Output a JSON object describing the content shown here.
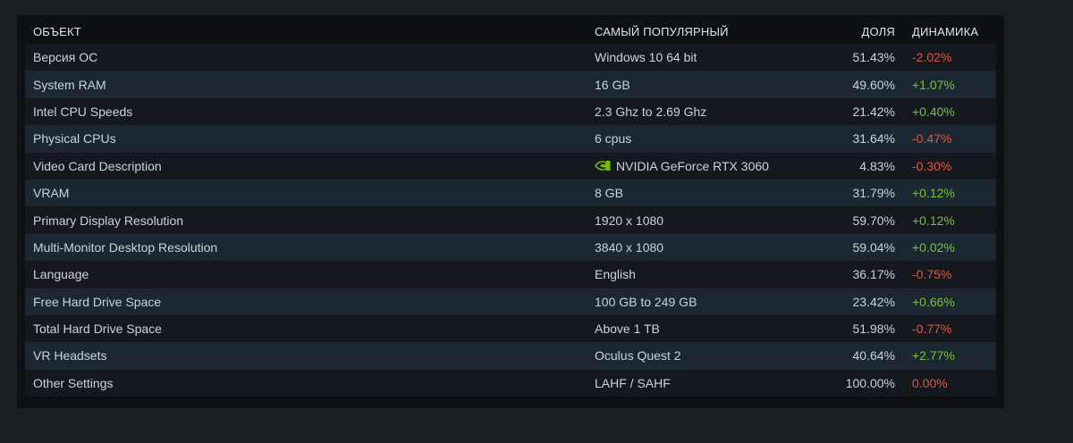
{
  "header": {
    "object": "ОБЪЕКТ",
    "popular": "САМЫЙ ПОПУЛЯРНЫЙ",
    "share": "ДОЛЯ",
    "dynamics": "ДИНАМИКА"
  },
  "rows": [
    {
      "object": "Версия ОС",
      "popular": "Windows 10 64 bit",
      "share": "51.43%",
      "dynamics": "-2.02%",
      "trend": "neg"
    },
    {
      "object": "System RAM",
      "popular": "16 GB",
      "share": "49.60%",
      "dynamics": "+1.07%",
      "trend": "pos"
    },
    {
      "object": "Intel CPU Speeds",
      "popular": "2.3 Ghz to 2.69 Ghz",
      "share": "21.42%",
      "dynamics": "+0.40%",
      "trend": "pos"
    },
    {
      "object": "Physical CPUs",
      "popular": "6 cpus",
      "share": "31.64%",
      "dynamics": "-0.47%",
      "trend": "neg"
    },
    {
      "object": "Video Card Description",
      "popular": "NVIDIA GeForce RTX 3060",
      "share": "4.83%",
      "dynamics": "-0.30%",
      "trend": "neg",
      "icon": "nvidia-logo-icon"
    },
    {
      "object": "VRAM",
      "popular": "8 GB",
      "share": "31.79%",
      "dynamics": "+0.12%",
      "trend": "pos"
    },
    {
      "object": "Primary Display Resolution",
      "popular": "1920 x 1080",
      "share": "59.70%",
      "dynamics": "+0.12%",
      "trend": "pos"
    },
    {
      "object": "Multi-Monitor Desktop Resolution",
      "popular": "3840 x 1080",
      "share": "59.04%",
      "dynamics": "+0.02%",
      "trend": "pos"
    },
    {
      "object": "Language",
      "popular": "English",
      "share": "36.17%",
      "dynamics": "-0.75%",
      "trend": "neg"
    },
    {
      "object": "Free Hard Drive Space",
      "popular": "100 GB to 249 GB",
      "share": "23.42%",
      "dynamics": "+0.66%",
      "trend": "pos"
    },
    {
      "object": "Total Hard Drive Space",
      "popular": "Above 1 TB",
      "share": "51.98%",
      "dynamics": "-0.77%",
      "trend": "neg"
    },
    {
      "object": "VR Headsets",
      "popular": "Oculus Quest 2",
      "share": "40.64%",
      "dynamics": "+2.77%",
      "trend": "pos"
    },
    {
      "object": "Other Settings",
      "popular": "LAHF / SAHF",
      "share": "100.00%",
      "dynamics": "0.00%",
      "trend": "zero"
    }
  ],
  "colors": {
    "positive": "#77c23a",
    "negative": "#e2563a",
    "nvidia_green": "#76b900"
  }
}
